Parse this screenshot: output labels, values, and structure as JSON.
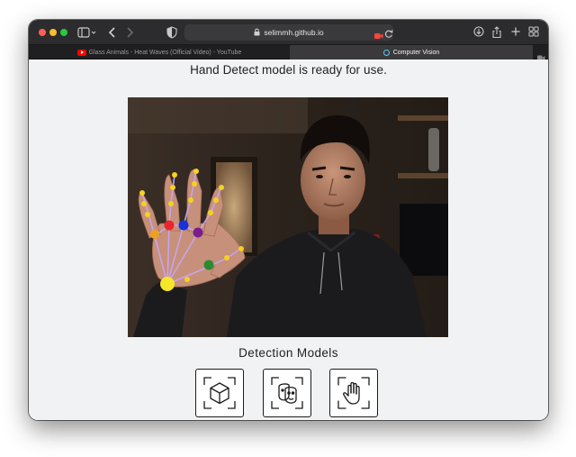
{
  "browser": {
    "address": "selimmh.github.io",
    "tabs": [
      {
        "title": "Glass Animals - Heat Waves (Official Video) - YouTube",
        "active": false,
        "favicon": "youtube-icon"
      },
      {
        "title": "Computer Vision",
        "active": true,
        "favicon": "computer-vision-icon"
      }
    ]
  },
  "page": {
    "status": "Hand Detect model is ready for use.",
    "models_title": "Detection Models",
    "models": [
      {
        "name": "object-detection",
        "icon": "cube-scan-icon"
      },
      {
        "name": "face-detection",
        "icon": "face-mask-scan-icon"
      },
      {
        "name": "hand-detection",
        "icon": "hand-scan-icon"
      }
    ]
  },
  "colors": {
    "landmark_yellow": "#f5d21f",
    "landmark_red": "#e8262b",
    "landmark_blue": "#1632d8",
    "landmark_purple": "#7a1d8c",
    "landmark_orange": "#f0a020",
    "landmark_green": "#2e8a2e",
    "skeleton_line": "#c7a6f2"
  }
}
